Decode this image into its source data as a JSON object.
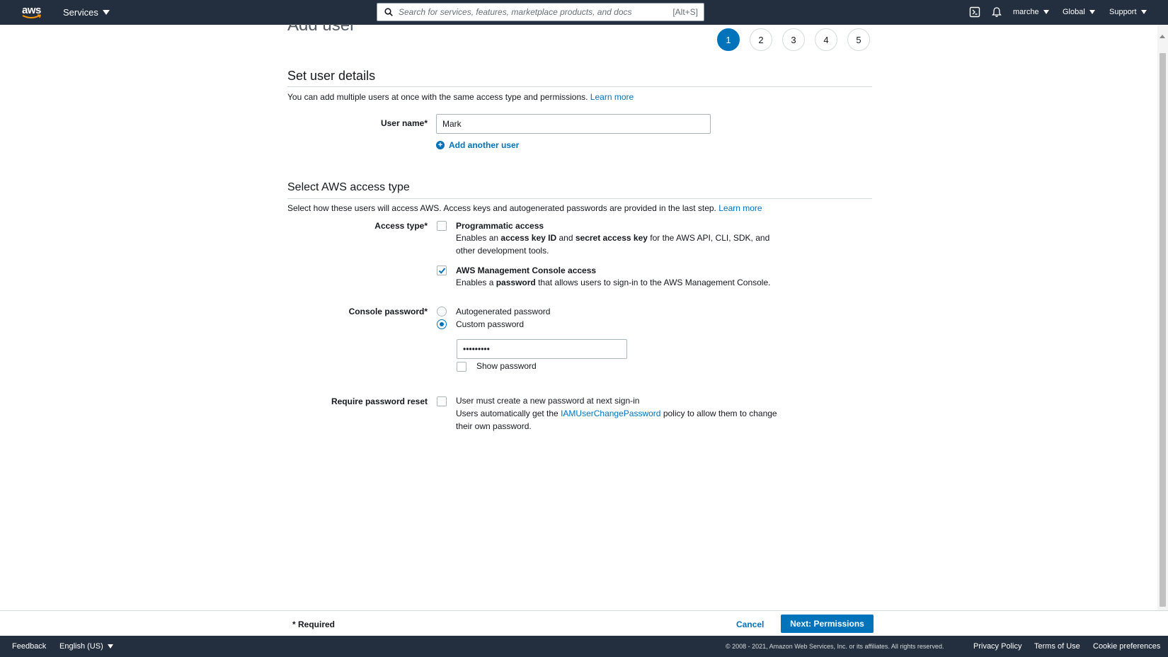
{
  "topnav": {
    "logo": "aws",
    "services_label": "Services",
    "search_placeholder": "Search for services, features, marketplace products, and docs",
    "search_shortcut": "[Alt+S]",
    "user_label": "marche",
    "region_label": "Global",
    "support_label": "Support",
    "icons": [
      "cloudshell-icon",
      "bell-icon"
    ]
  },
  "page": {
    "title": "Add user",
    "steps": [
      "1",
      "2",
      "3",
      "4",
      "5"
    ],
    "active_step": 1
  },
  "user_details": {
    "title": "Set user details",
    "description": "You can add multiple users at once with the same access type and permissions.",
    "learn_more": "Learn more",
    "user_name_label": "User name*",
    "user_name_value": "Mark",
    "add_another_user": "Add another user"
  },
  "access_type": {
    "title": "Select AWS access type",
    "description": "Select how these users will access AWS. Access keys and autogenerated passwords are provided in the last step.",
    "learn_more": "Learn more",
    "label": "Access type*",
    "programmatic": {
      "title": "Programmatic access",
      "checked": false,
      "desc_pre": "Enables an",
      "desc_b1": "access key ID",
      "desc_mid": "and",
      "desc_b2": "secret access key",
      "desc_post": "for the AWS API, CLI, SDK, and",
      "desc_line2": "other development tools."
    },
    "console": {
      "title": "AWS Management Console access",
      "checked": true,
      "desc_pre": "Enables a",
      "desc_b": "password",
      "desc_post": "that allows users to sign-in to the AWS Management Console."
    }
  },
  "console_password": {
    "label": "Console password*",
    "options": [
      {
        "label": "Autogenerated password",
        "selected": false
      },
      {
        "label": "Custom password",
        "selected": true
      }
    ],
    "password_value": "•••••••••",
    "show_password_label": "Show password",
    "show_password_checked": false
  },
  "password_reset": {
    "label": "Require password reset",
    "checked": false,
    "option_label": "User must create a new password at next sign-in",
    "desc_pre": "Users automatically get the",
    "desc_link": "IAMUserChangePassword",
    "desc_post": "policy to allow them to change",
    "desc_line2": "their own password."
  },
  "actions": {
    "required_note": "* Required",
    "cancel": "Cancel",
    "next": "Next: Permissions"
  },
  "footer": {
    "feedback": "Feedback",
    "language": "English (US)",
    "copyright": "© 2008 - 2021, Amazon Web Services, Inc. or its affiliates. All rights reserved.",
    "privacy": "Privacy Policy",
    "terms": "Terms of Use",
    "cookies": "Cookie preferences"
  },
  "colors": {
    "nav_bg": "#232f3e",
    "link": "#0073bb",
    "primary_button": "#0073bb",
    "text": "#16191f"
  }
}
